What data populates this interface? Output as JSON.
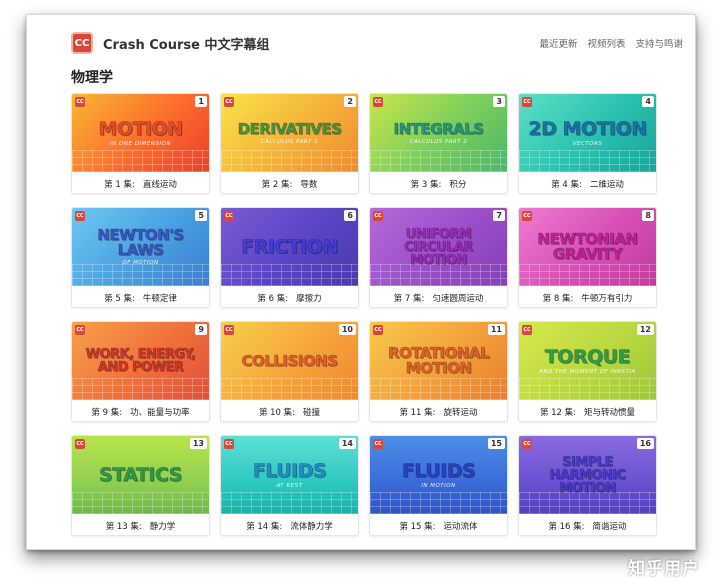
{
  "header": {
    "logo_text": "CC",
    "site_title": "Crash Course 中文字幕组",
    "nav": [
      "最近更新",
      "视频列表",
      "支持与鸣谢"
    ]
  },
  "section_title": "物理学",
  "cards": [
    {
      "num": "1",
      "title": "MOTION",
      "subtitle": "IN ONE DIMENSION",
      "caption_ep": "第 1 集:",
      "caption_name": "直线运动",
      "bg": "linear-gradient(135deg,#f7b733 0%,#fc6c2c 55%,#e8412c 100%)",
      "fg": "#e84a2a",
      "size": ""
    },
    {
      "num": "2",
      "title": "DERIVATIVES",
      "subtitle": "CALCULUS PART 1",
      "caption_ep": "第 2 集:",
      "caption_name": "导数",
      "bg": "linear-gradient(135deg,#f9e34a 0%,#f5b63a 50%,#f08a2e 100%)",
      "fg": "#3d9a45",
      "size": "small"
    },
    {
      "num": "3",
      "title": "INTEGRALS",
      "subtitle": "CALCULUS PART 2",
      "caption_ep": "第 3 集:",
      "caption_name": "积分",
      "bg": "linear-gradient(135deg,#c9e64a 0%,#7fd05a 50%,#4bb86a 100%)",
      "fg": "#1f9a8a",
      "size": "small"
    },
    {
      "num": "4",
      "title": "2D MOTION",
      "subtitle": "VECTORS",
      "caption_ep": "第 4 集:",
      "caption_name": "二维运动",
      "bg": "linear-gradient(135deg,#5ee0c6 0%,#2cc4b0 50%,#18a39c 100%)",
      "fg": "#1d6fb0",
      "size": ""
    },
    {
      "num": "5",
      "title": "NEWTON'S LAWS",
      "subtitle": "OF MOTION",
      "caption_ep": "第 5 集:",
      "caption_name": "牛顿定律",
      "bg": "linear-gradient(135deg,#6fc7f2 0%,#4a9fe0 55%,#3b7fd0 100%)",
      "fg": "#3a56c8",
      "size": "small"
    },
    {
      "num": "6",
      "title": "FRICTION",
      "subtitle": "",
      "caption_ep": "第 6 集:",
      "caption_name": "摩擦力",
      "bg": "linear-gradient(135deg,#7a5ad6 0%,#5a44c4 55%,#4a3ab0 100%)",
      "fg": "#3f3fd8",
      "size": ""
    },
    {
      "num": "7",
      "title": "UNIFORM CIRCULAR MOTION",
      "subtitle": "",
      "caption_ep": "第 7 集:",
      "caption_name": "匀速圆周运动",
      "bg": "linear-gradient(135deg,#b46ad8 0%,#9a4ec8 55%,#8440b8 100%)",
      "fg": "#a02ac0",
      "size": "tiny"
    },
    {
      "num": "8",
      "title": "NEWTONIAN GRAVITY",
      "subtitle": "",
      "caption_ep": "第 8 集:",
      "caption_name": "牛顿万有引力",
      "bg": "linear-gradient(135deg,#f07ad0 0%,#d64fb4 55%,#c23ca0 100%)",
      "fg": "#c4209a",
      "size": "small"
    },
    {
      "num": "9",
      "title": "WORK, ENERGY, AND POWER",
      "subtitle": "",
      "caption_ep": "第 9 集:",
      "caption_name": "功、能量与功率",
      "bg": "linear-gradient(135deg,#f7a04a 0%,#f0703a 55%,#e0503a 100%)",
      "fg": "#d8342c",
      "size": "tiny"
    },
    {
      "num": "10",
      "title": "COLLISIONS",
      "subtitle": "",
      "caption_ep": "第 10 集:",
      "caption_name": "碰撞",
      "bg": "linear-gradient(135deg,#f7d04a 0%,#f5a43a 55%,#ef8a2e 100%)",
      "fg": "#ee5a2a",
      "size": "small"
    },
    {
      "num": "11",
      "title": "ROTATIONAL MOTION",
      "subtitle": "",
      "caption_ep": "第 11 集:",
      "caption_name": "旋转运动",
      "bg": "linear-gradient(135deg,#f9c94a 0%,#f3a03a 55%,#ea7e2e 100%)",
      "fg": "#e8602a",
      "size": "small"
    },
    {
      "num": "12",
      "title": "TORQUE",
      "subtitle": "AND THE MOMENT OF INERTIA",
      "caption_ep": "第 12 集:",
      "caption_name": "矩与转动惯量",
      "bg": "linear-gradient(135deg,#d8e84a 0%,#b9d840 55%,#9cc83a 100%)",
      "fg": "#2aa04a",
      "size": ""
    },
    {
      "num": "13",
      "title": "STATICS",
      "subtitle": "",
      "caption_ep": "第 13 集:",
      "caption_name": "静力学",
      "bg": "linear-gradient(180deg,#b9e44a 0%,#8fd050 60%,#6cb84a 100%)",
      "fg": "#2b9a4c",
      "size": ""
    },
    {
      "num": "14",
      "title": "FLUIDS",
      "subtitle": "AT REST",
      "caption_ep": "第 14 集:",
      "caption_name": "流体静力学",
      "bg": "linear-gradient(180deg,#5ee0d6 0%,#2cc8c0 60%,#1cb0a8 100%)",
      "fg": "#1f8ec8",
      "size": ""
    },
    {
      "num": "15",
      "title": "FLUIDS",
      "subtitle": "IN MOTION",
      "caption_ep": "第 15 集:",
      "caption_name": "运动流体",
      "bg": "linear-gradient(180deg,#4a8ee8 0%,#3a6cd8 60%,#2f54c4 100%)",
      "fg": "#2a3fc8",
      "size": ""
    },
    {
      "num": "16",
      "title": "SIMPLE HARMONIC MOTION",
      "subtitle": "",
      "caption_ep": "第 16 集:",
      "caption_name": "简谐运动",
      "bg": "linear-gradient(180deg,#8a6ae0 0%,#6a52d0 60%,#5440bc 100%)",
      "fg": "#4a3ad8",
      "size": "tiny"
    }
  ],
  "watermark": "知乎用户"
}
